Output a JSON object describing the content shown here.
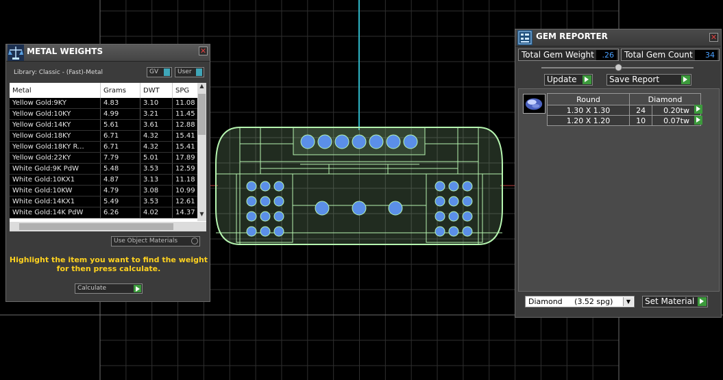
{
  "metal_weights": {
    "title": "METAL WEIGHTS",
    "library_label": "Library: Classic - (Fast)-Metal",
    "gv_label": "GV",
    "user_label": "User",
    "columns": [
      "Metal",
      "Grams",
      "DWT",
      "SPG"
    ],
    "rows": [
      [
        "Yellow Gold:9KY",
        "4.83",
        "3.10",
        "11.08"
      ],
      [
        "Yellow Gold:10KY",
        "4.99",
        "3.21",
        "11.45"
      ],
      [
        "Yellow Gold:14KY",
        "5.61",
        "3.61",
        "12.88"
      ],
      [
        "Yellow Gold:18KY",
        "6.71",
        "4.32",
        "15.41"
      ],
      [
        "Yellow Gold:18KY R...",
        "6.71",
        "4.32",
        "15.41"
      ],
      [
        "Yellow Gold:22KY",
        "7.79",
        "5.01",
        "17.89"
      ],
      [
        "White Gold:9K PdW",
        "5.48",
        "3.53",
        "12.59"
      ],
      [
        "White Gold:10KX1",
        "4.87",
        "3.13",
        "11.18"
      ],
      [
        "White Gold:10KW",
        "4.79",
        "3.08",
        "10.99"
      ],
      [
        "White Gold:14KX1",
        "5.49",
        "3.53",
        "12.61"
      ],
      [
        "White Gold:14K PdW",
        "6.26",
        "4.02",
        "14.37"
      ]
    ],
    "use_object_materials": "Use Object Materials",
    "hint_line1": "Highlight the item you want to find the weight",
    "hint_line2": "for then press calculate.",
    "calculate_label": "Calculate"
  },
  "gem_reporter": {
    "title": "GEM REPORTER",
    "total_weight_label": "Total Gem Weight",
    "total_weight_value": ".26",
    "total_count_label": "Total Gem Count",
    "total_count_value": "34",
    "update_label": "Update",
    "save_report_label": "Save Report",
    "shape_header": "Round",
    "material_header": "Diamond",
    "gems": [
      {
        "size": "1.30 X 1.30",
        "count": "24",
        "weight": "0.20tw"
      },
      {
        "size": "1.20 X 1.20",
        "count": "10",
        "weight": "0.07tw"
      }
    ],
    "material_select": "Diamond     (3.52 spg)",
    "set_material_label": "Set Material"
  },
  "colors": {
    "wireframe": "#b6f5b0",
    "gem_blue": "#5b8fe8",
    "axis_cyan": "#2fb4c4",
    "hint_yellow": "#ffd21f",
    "go_green": "#3c9a3c"
  },
  "icons": {
    "metal_weights": "scale-icon",
    "gem_reporter": "gem-report-icon",
    "gem_type": "round-diamond-icon"
  }
}
